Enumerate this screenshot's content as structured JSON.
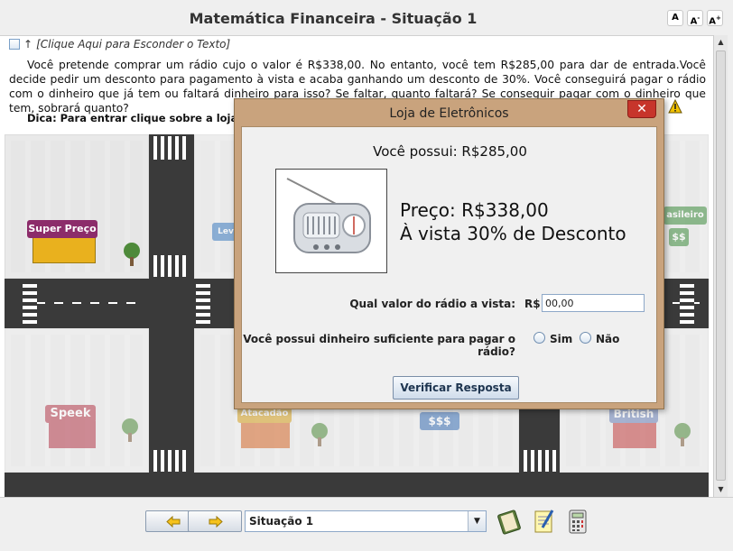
{
  "header": {
    "title": "Matemática Financeira - Situação 1",
    "font_buttons": [
      "A",
      "A-",
      "A+"
    ]
  },
  "toggle": {
    "label": "[Clique Aqui para Esconder o Texto]",
    "arrow": "↑"
  },
  "problem_text": "Você pretende comprar um rádio cujo o valor é R$338,00. No entanto, você tem R$285,00 para dar de entrada.Você decide pedir um desconto para pagamento à vista e acaba ganhando um desconto de 30%. Você conseguirá pagar o rádio com o dinheiro que já tem ou faltará dinheiro para isso? Se faltar, quanto faltará? Se conseguir pagar com o dinheiro que tem, sobrará quanto?",
  "hint": "Dica: Para entrar clique sobre a loja em d",
  "map": {
    "stores": [
      "Super Preço",
      "Lev",
      "asileiro",
      "Speek",
      "Atacadão",
      "British"
    ],
    "money_signs": [
      "$$",
      "$$$"
    ]
  },
  "dialog": {
    "title": "Loja de Eletrônicos",
    "close_symbol": "✕",
    "owned": "Você possui: R$285,00",
    "price": "Preço: R$338,00",
    "discount": "À vista 30% de Desconto",
    "question_value": "Qual valor do rádio a vista:",
    "currency": "R$",
    "value_input": "00,00",
    "question_enough": "Você possui dinheiro suficiente para pagar o rádio?",
    "option_yes": "Sim",
    "option_no": "Não",
    "verify_button": "Verificar Resposta"
  },
  "bottombar": {
    "selected_situation": "Situação 1",
    "icons": [
      "arrow-left-icon",
      "arrow-right-icon",
      "book-icon",
      "notepad-icon",
      "calculator-icon"
    ]
  },
  "colors": {
    "dialog_frame": "#c9a37d",
    "close_button": "#c7352b",
    "road": "#3a3a3a"
  }
}
